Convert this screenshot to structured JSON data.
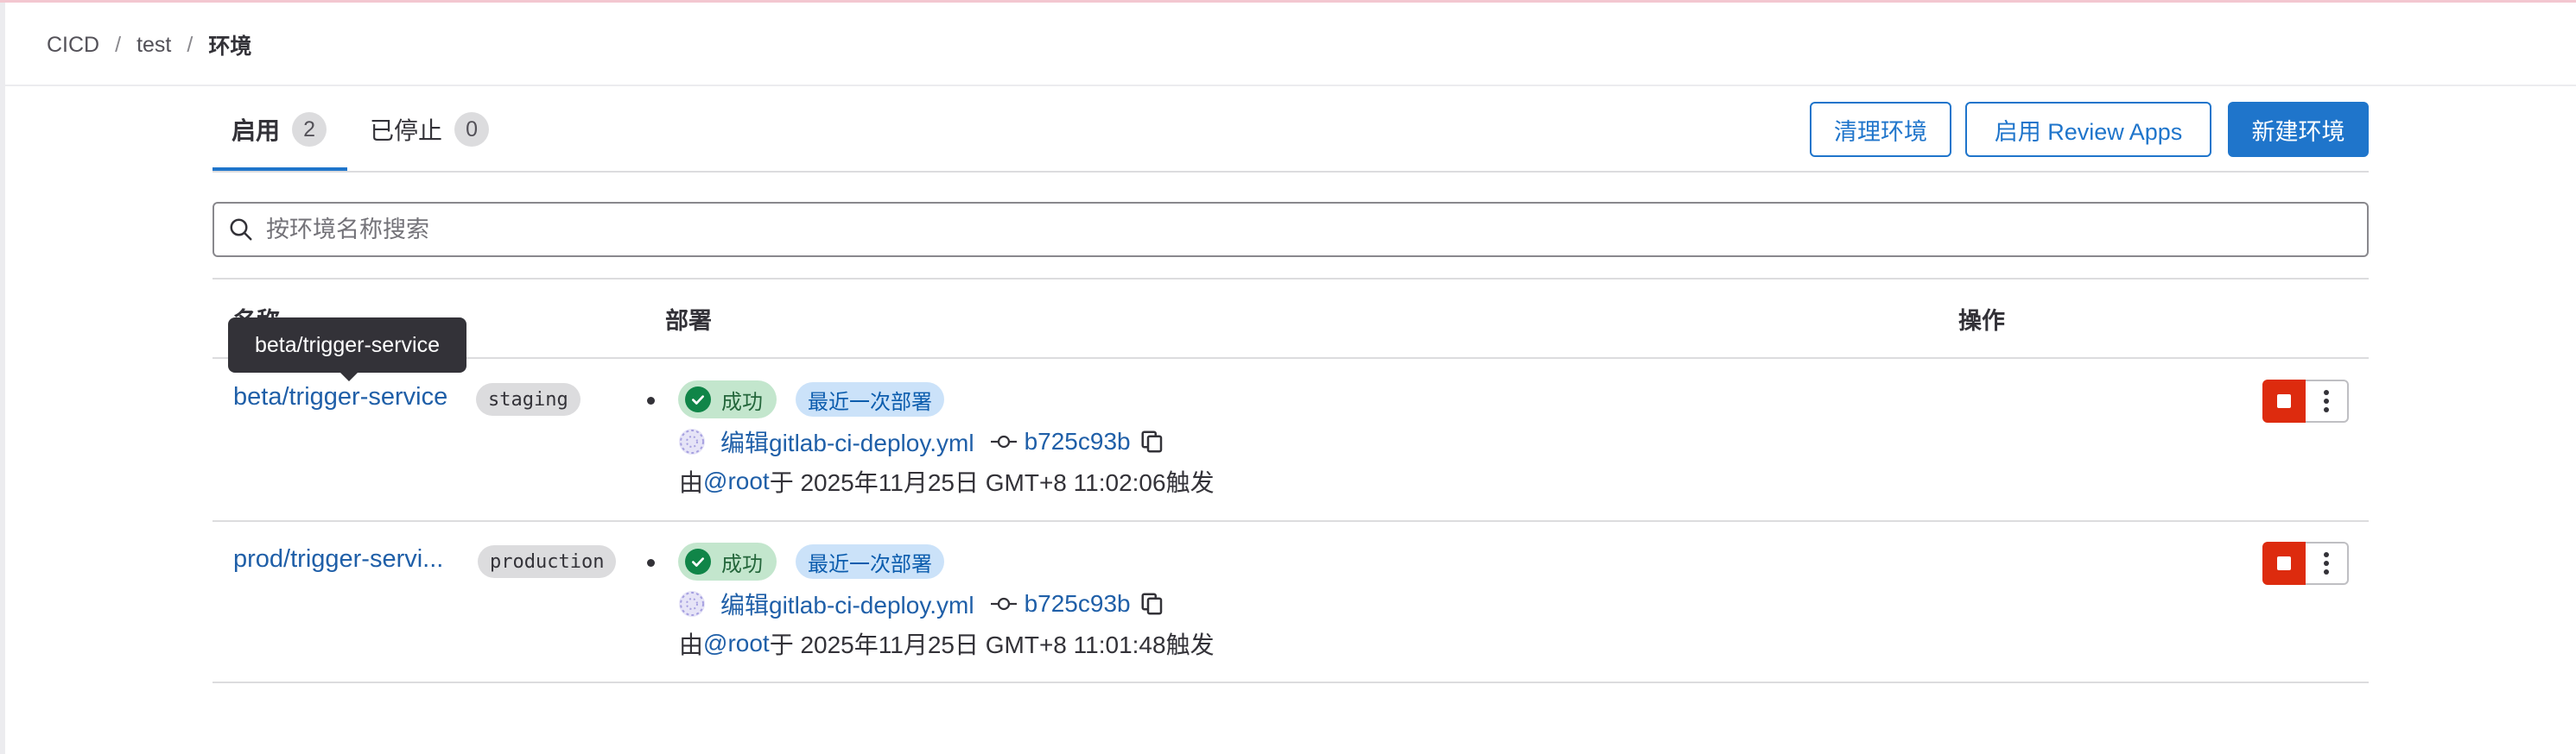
{
  "breadcrumb": {
    "group": "CICD",
    "project": "test",
    "current": "环境",
    "separator": "/"
  },
  "tabs": [
    {
      "label": "启用",
      "count": "2"
    },
    {
      "label": "已停止",
      "count": "0"
    }
  ],
  "actions": {
    "clean": "清理环境",
    "review_apps": "启用 Review Apps",
    "new_env": "新建环境"
  },
  "search": {
    "placeholder": "按环境名称搜索",
    "value": ""
  },
  "table": {
    "headers": {
      "name": "名称",
      "deploy": "部署",
      "actions": "操作"
    },
    "rows": [
      {
        "name": "beta/trigger-service",
        "tier": "staging",
        "status": "成功",
        "latest": "最近一次部署",
        "commit_title": "编辑gitlab-ci-deploy.yml",
        "sha": "b725c93b",
        "by": "由",
        "user": "@root",
        "time": "于 2025年11月25日 GMT+8 11:02:06",
        "action": "触发"
      },
      {
        "name": "prod/trigger-servi...",
        "tier": "production",
        "status": "成功",
        "latest": "最近一次部署",
        "commit_title": "编辑gitlab-ci-deploy.yml",
        "sha": "b725c93b",
        "by": "由",
        "user": "@root",
        "time": "于 2025年11月25日 GMT+8 11:01:48",
        "action": "触发"
      }
    ]
  },
  "tooltip": {
    "text": "beta/trigger-service"
  },
  "colors": {
    "accent": "#1f75cb",
    "danger": "#dd2b0e",
    "success": "#108548",
    "link": "#1f5fa8"
  },
  "icons": [
    "search-icon",
    "check-circle-icon",
    "commit-icon",
    "copy-icon",
    "stop-icon",
    "kebab-icon",
    "avatar-icon"
  ]
}
